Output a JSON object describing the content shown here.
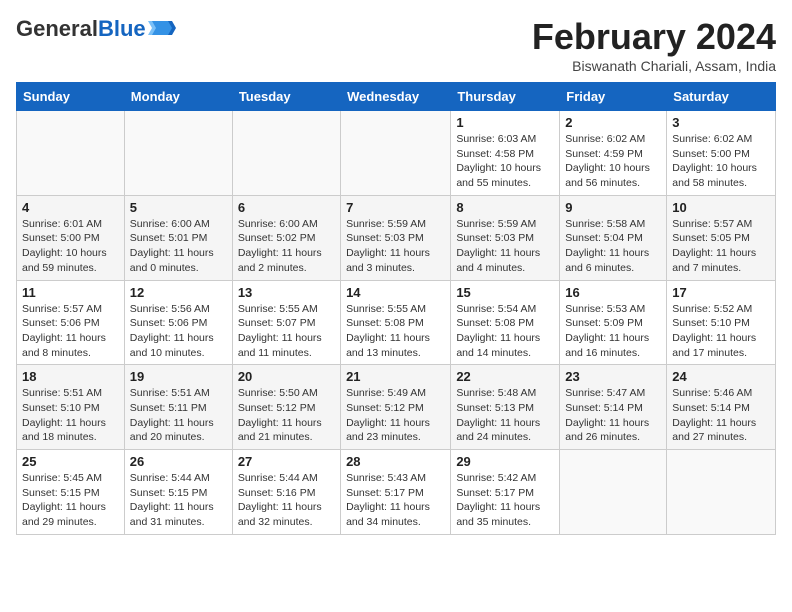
{
  "header": {
    "logo_general": "General",
    "logo_blue": "Blue",
    "title": "February 2024",
    "subtitle": "Biswanath Chariali, Assam, India"
  },
  "days_of_week": [
    "Sunday",
    "Monday",
    "Tuesday",
    "Wednesday",
    "Thursday",
    "Friday",
    "Saturday"
  ],
  "weeks": [
    [
      {
        "day": "",
        "info": ""
      },
      {
        "day": "",
        "info": ""
      },
      {
        "day": "",
        "info": ""
      },
      {
        "day": "",
        "info": ""
      },
      {
        "day": "1",
        "info": "Sunrise: 6:03 AM\nSunset: 4:58 PM\nDaylight: 10 hours and 55 minutes."
      },
      {
        "day": "2",
        "info": "Sunrise: 6:02 AM\nSunset: 4:59 PM\nDaylight: 10 hours and 56 minutes."
      },
      {
        "day": "3",
        "info": "Sunrise: 6:02 AM\nSunset: 5:00 PM\nDaylight: 10 hours and 58 minutes."
      }
    ],
    [
      {
        "day": "4",
        "info": "Sunrise: 6:01 AM\nSunset: 5:00 PM\nDaylight: 10 hours and 59 minutes."
      },
      {
        "day": "5",
        "info": "Sunrise: 6:00 AM\nSunset: 5:01 PM\nDaylight: 11 hours and 0 minutes."
      },
      {
        "day": "6",
        "info": "Sunrise: 6:00 AM\nSunset: 5:02 PM\nDaylight: 11 hours and 2 minutes."
      },
      {
        "day": "7",
        "info": "Sunrise: 5:59 AM\nSunset: 5:03 PM\nDaylight: 11 hours and 3 minutes."
      },
      {
        "day": "8",
        "info": "Sunrise: 5:59 AM\nSunset: 5:03 PM\nDaylight: 11 hours and 4 minutes."
      },
      {
        "day": "9",
        "info": "Sunrise: 5:58 AM\nSunset: 5:04 PM\nDaylight: 11 hours and 6 minutes."
      },
      {
        "day": "10",
        "info": "Sunrise: 5:57 AM\nSunset: 5:05 PM\nDaylight: 11 hours and 7 minutes."
      }
    ],
    [
      {
        "day": "11",
        "info": "Sunrise: 5:57 AM\nSunset: 5:06 PM\nDaylight: 11 hours and 8 minutes."
      },
      {
        "day": "12",
        "info": "Sunrise: 5:56 AM\nSunset: 5:06 PM\nDaylight: 11 hours and 10 minutes."
      },
      {
        "day": "13",
        "info": "Sunrise: 5:55 AM\nSunset: 5:07 PM\nDaylight: 11 hours and 11 minutes."
      },
      {
        "day": "14",
        "info": "Sunrise: 5:55 AM\nSunset: 5:08 PM\nDaylight: 11 hours and 13 minutes."
      },
      {
        "day": "15",
        "info": "Sunrise: 5:54 AM\nSunset: 5:08 PM\nDaylight: 11 hours and 14 minutes."
      },
      {
        "day": "16",
        "info": "Sunrise: 5:53 AM\nSunset: 5:09 PM\nDaylight: 11 hours and 16 minutes."
      },
      {
        "day": "17",
        "info": "Sunrise: 5:52 AM\nSunset: 5:10 PM\nDaylight: 11 hours and 17 minutes."
      }
    ],
    [
      {
        "day": "18",
        "info": "Sunrise: 5:51 AM\nSunset: 5:10 PM\nDaylight: 11 hours and 18 minutes."
      },
      {
        "day": "19",
        "info": "Sunrise: 5:51 AM\nSunset: 5:11 PM\nDaylight: 11 hours and 20 minutes."
      },
      {
        "day": "20",
        "info": "Sunrise: 5:50 AM\nSunset: 5:12 PM\nDaylight: 11 hours and 21 minutes."
      },
      {
        "day": "21",
        "info": "Sunrise: 5:49 AM\nSunset: 5:12 PM\nDaylight: 11 hours and 23 minutes."
      },
      {
        "day": "22",
        "info": "Sunrise: 5:48 AM\nSunset: 5:13 PM\nDaylight: 11 hours and 24 minutes."
      },
      {
        "day": "23",
        "info": "Sunrise: 5:47 AM\nSunset: 5:14 PM\nDaylight: 11 hours and 26 minutes."
      },
      {
        "day": "24",
        "info": "Sunrise: 5:46 AM\nSunset: 5:14 PM\nDaylight: 11 hours and 27 minutes."
      }
    ],
    [
      {
        "day": "25",
        "info": "Sunrise: 5:45 AM\nSunset: 5:15 PM\nDaylight: 11 hours and 29 minutes."
      },
      {
        "day": "26",
        "info": "Sunrise: 5:44 AM\nSunset: 5:15 PM\nDaylight: 11 hours and 31 minutes."
      },
      {
        "day": "27",
        "info": "Sunrise: 5:44 AM\nSunset: 5:16 PM\nDaylight: 11 hours and 32 minutes."
      },
      {
        "day": "28",
        "info": "Sunrise: 5:43 AM\nSunset: 5:17 PM\nDaylight: 11 hours and 34 minutes."
      },
      {
        "day": "29",
        "info": "Sunrise: 5:42 AM\nSunset: 5:17 PM\nDaylight: 11 hours and 35 minutes."
      },
      {
        "day": "",
        "info": ""
      },
      {
        "day": "",
        "info": ""
      }
    ]
  ]
}
